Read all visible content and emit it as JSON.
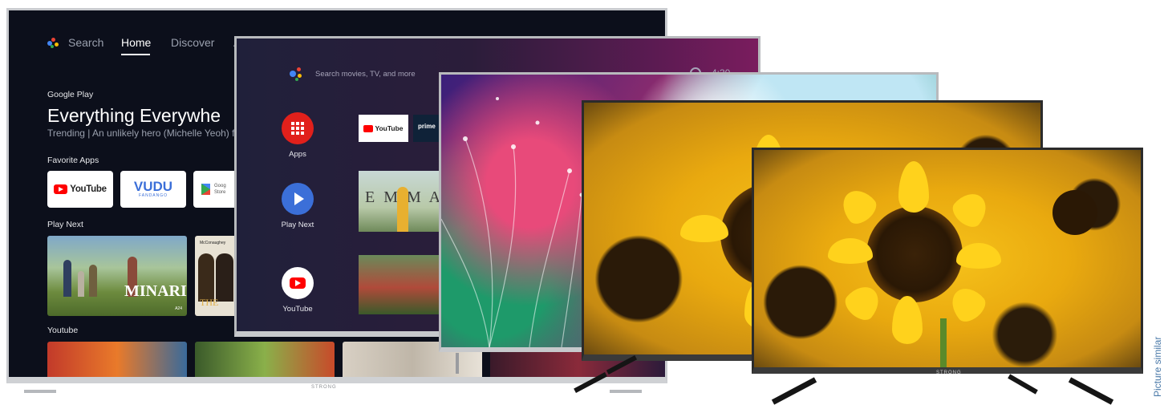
{
  "google_tv": {
    "nav": {
      "search": "Search",
      "home": "Home",
      "discover": "Discover",
      "apps_partial": "A"
    },
    "brand": "Google Play",
    "hero_title": "Everything Everywhe",
    "hero_subtitle": "Trending | An unlikely hero (Michelle Yeoh) f",
    "sections": {
      "favorite_apps": "Favorite Apps",
      "play_next": "Play Next",
      "youtube": "Youtube"
    },
    "apps": [
      {
        "label": "YouTube",
        "color": "#ff0000"
      },
      {
        "label": "VUDU",
        "sub": "FANDANGO",
        "color": "#3b6fd8"
      },
      {
        "label": "Google Play Store",
        "short": "Goog",
        "short2": "Store"
      }
    ],
    "play_next": [
      {
        "title": "MINARI",
        "rating": "A24"
      },
      {
        "title": "THE",
        "credit": "McConaughey"
      }
    ],
    "brand_logo": "STRONG"
  },
  "android_tv": {
    "search_placeholder": "Search movies, TV, and more",
    "clock": "4:30",
    "side_items": [
      {
        "label": "Apps",
        "icon": "apps-grid-icon",
        "color": "#e1201b"
      },
      {
        "label": "Play Next",
        "icon": "play-icon",
        "color": "#3b6fd8"
      },
      {
        "label": "YouTube",
        "icon": "youtube-icon",
        "color": "#ffffff"
      }
    ],
    "row_apps": [
      {
        "label": "YouTube"
      },
      {
        "label": "prime"
      }
    ],
    "movie_title": "E M M A"
  },
  "tv_brand": "STRONG",
  "side_note": "Picture similar"
}
